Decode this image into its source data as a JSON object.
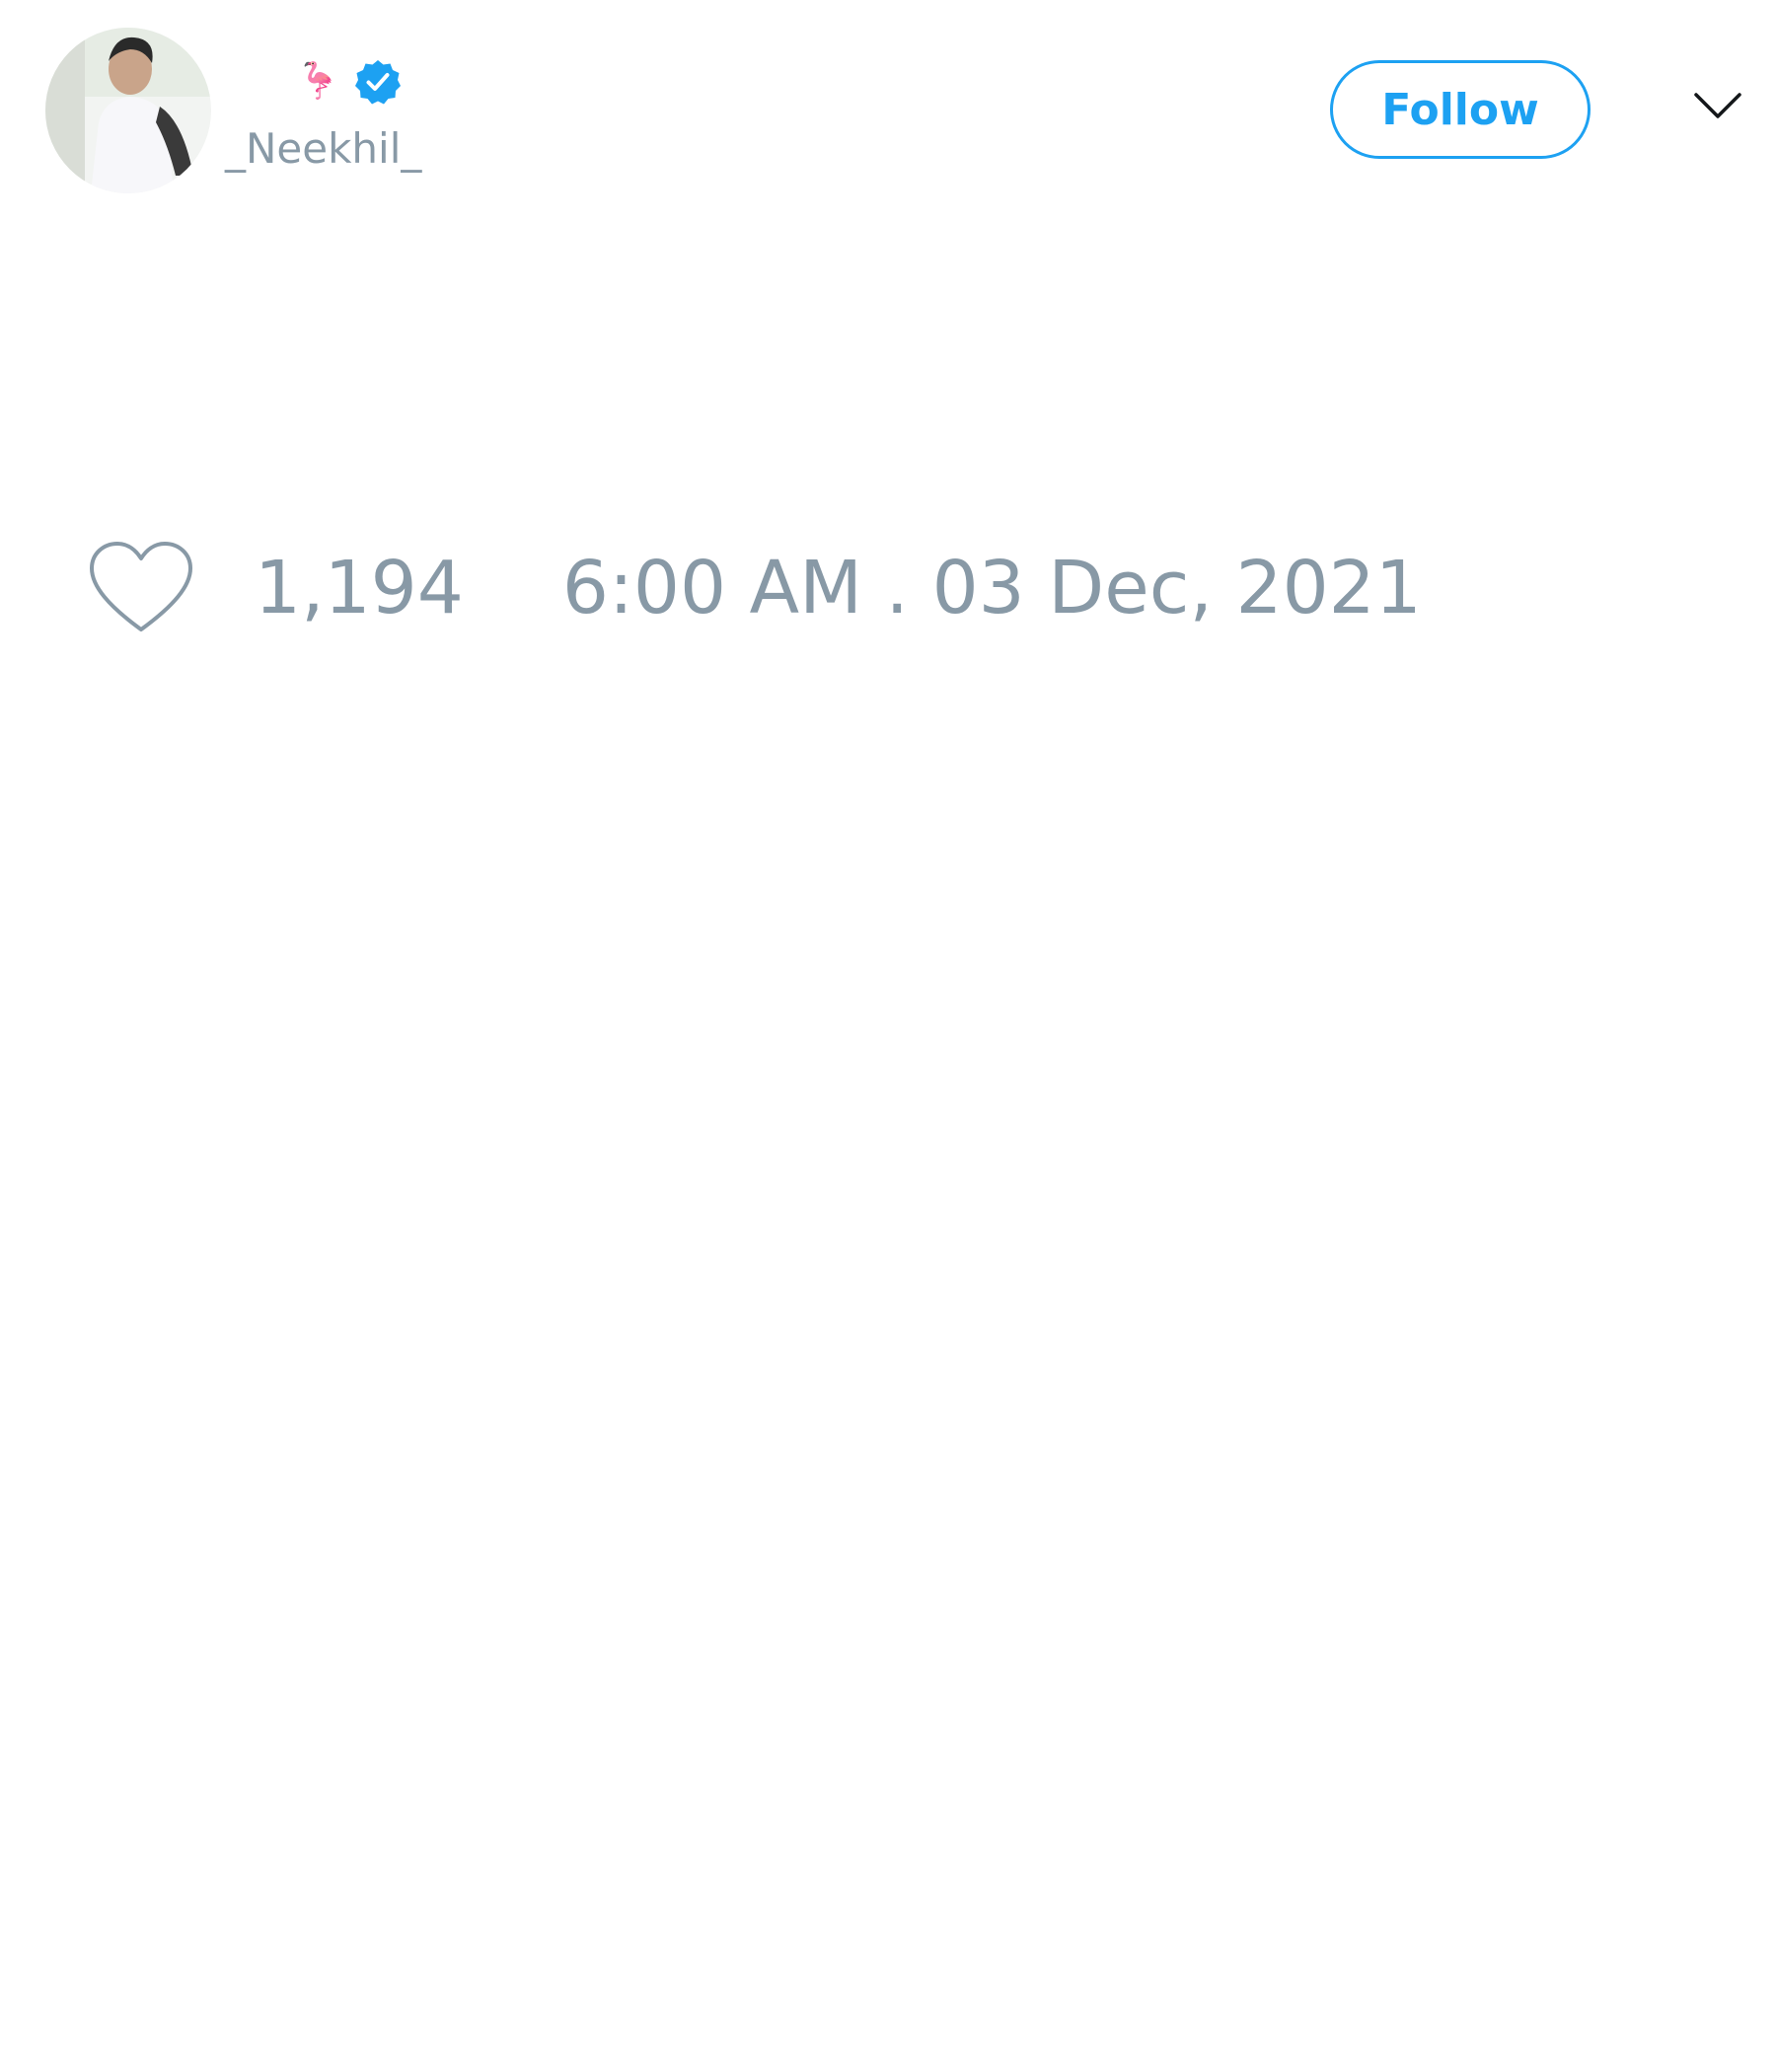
{
  "tweet": {
    "user": {
      "display_name_emoji": "🦩",
      "verified": true,
      "handle": "_Neekhil_"
    },
    "follow_label": "Follow",
    "likes": "1,194",
    "timestamp": "6:00 AM . 03 Dec, 2021"
  },
  "colors": {
    "accent": "#1da1f2",
    "muted_text": "#8899a6",
    "emoji": "#e0457b"
  },
  "icons": {
    "verified": "verified-badge-icon",
    "menu": "chevron-down-icon",
    "like": "heart-outline-icon"
  }
}
